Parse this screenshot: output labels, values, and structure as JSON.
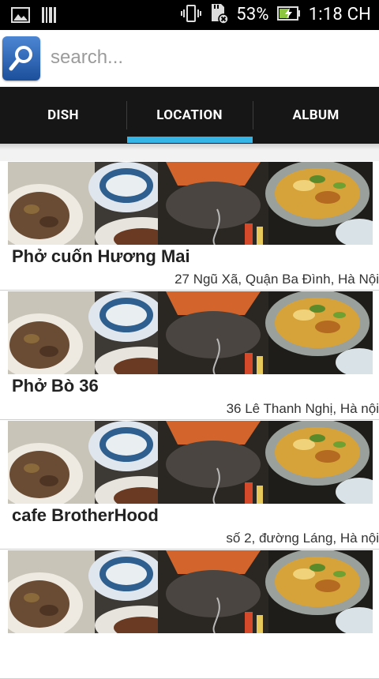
{
  "status_bar": {
    "battery_percent": "53%",
    "time": "1:18 CH",
    "icons": [
      "image-icon",
      "barcode-icon",
      "vibrate-icon",
      "sd-card-error-icon",
      "battery-charging-icon"
    ]
  },
  "search": {
    "placeholder": "search...",
    "icon": "search-icon"
  },
  "tabs": [
    {
      "label": "DISH"
    },
    {
      "label": "LOCATION"
    },
    {
      "label": "ALBUM"
    }
  ],
  "selected_tab": "LOCATION",
  "colors": {
    "tab_indicator": "#35b5e5",
    "tab_bar_bg": "#161616",
    "search_button": "#2a63b5"
  },
  "locations": [
    {
      "name": "Phở cuốn Hương Mai",
      "address": "27 Ngũ Xã, Quận Ba Đình, Hà Nội"
    },
    {
      "name": "Phở Bò 36",
      "address": "36 Lê Thanh Nghị, Hà nội"
    },
    {
      "name": "cafe BrotherHood",
      "address": "số 2, đường Láng, Hà nội"
    },
    {
      "name": "",
      "address": ""
    }
  ]
}
